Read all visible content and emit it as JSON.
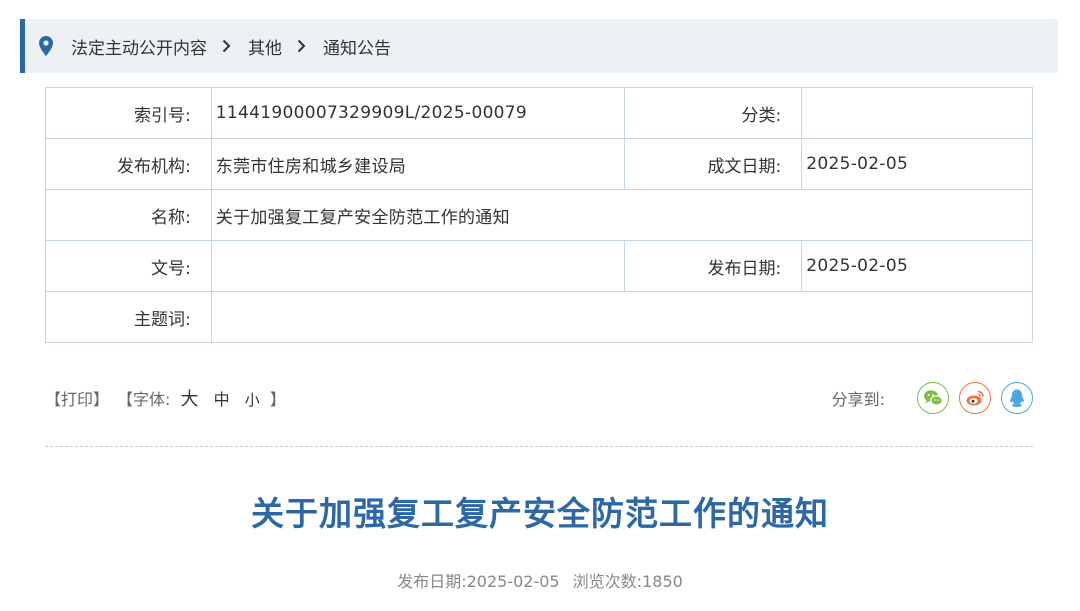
{
  "breadcrumb": {
    "items": [
      "法定主动公开内容",
      "其他",
      "通知公告"
    ]
  },
  "meta": {
    "index_label": "索引号:",
    "index_value": "11441900007329909L/2025-00079",
    "category_label": "分类:",
    "category_value": "",
    "publisher_label": "发布机构:",
    "publisher_value": "东莞市住房和城乡建设局",
    "written_date_label": "成文日期:",
    "written_date_value": "2025-02-05",
    "name_label": "名称:",
    "name_value": "关于加强复工复产安全防范工作的通知",
    "doc_no_label": "文号:",
    "doc_no_value": "",
    "publish_date_label": "发布日期:",
    "publish_date_value": "2025-02-05",
    "keywords_label": "主题词:",
    "keywords_value": ""
  },
  "toolbar": {
    "print": "【打印】",
    "font_open": "【字体:",
    "font_large": "大",
    "font_medium": "中",
    "font_small": "小",
    "font_close": "】",
    "share_label": "分享到:",
    "share_icons": [
      "wechat-icon",
      "weibo-icon",
      "qq-icon"
    ]
  },
  "article": {
    "title": "关于加强复工复产安全防范工作的通知",
    "publish_date_label": "发布日期:",
    "publish_date": "2025-02-05",
    "views_label": "浏览次数:",
    "views": "1850"
  },
  "colors": {
    "accent": "#2c68a6",
    "breadcrumb_bg": "#eef1f4",
    "table_border": "#c7d6e4",
    "wechat": "#7cbf3f",
    "weibo": "#e8764a",
    "qq": "#4aa8e0"
  }
}
